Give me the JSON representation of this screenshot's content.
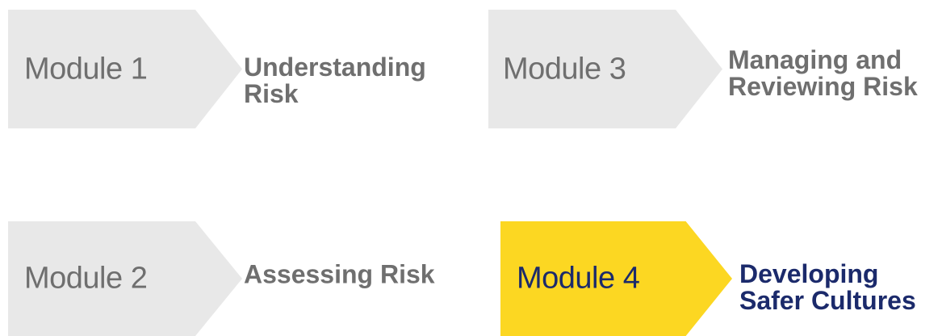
{
  "modules": [
    {
      "label": "Module 1",
      "title_lines": [
        "Understanding",
        "Risk"
      ],
      "active": false
    },
    {
      "label": "Module 2",
      "title_lines": [
        "Assessing Risk"
      ],
      "active": false
    },
    {
      "label": "Module 3",
      "title_lines": [
        "Managing and",
        "Reviewing Risk"
      ],
      "active": false
    },
    {
      "label": "Module 4",
      "title_lines": [
        "Developing",
        "Safer Cultures"
      ],
      "active": true
    }
  ],
  "colors": {
    "inactive_fill": "#e8e8e8",
    "active_fill": "#fcd722",
    "inactive_text": "#6f6f6f",
    "active_text": "#1b2a6b"
  }
}
